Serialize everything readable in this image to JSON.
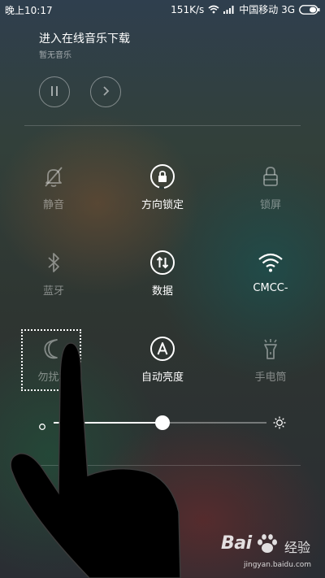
{
  "status_bar": {
    "time": "晚上10:17",
    "speed": "151K/s",
    "carrier": "中国移动 3G"
  },
  "music": {
    "title": "进入在线音乐下载",
    "subtitle": "暂无音乐",
    "pause_icon": "pause-icon",
    "next_icon": "chevron-right-icon"
  },
  "toggles": [
    {
      "label": "静音",
      "icon": "bell-off-icon",
      "active": false
    },
    {
      "label": "方向锁定",
      "icon": "rotation-lock-icon",
      "active": true
    },
    {
      "label": "锁屏",
      "icon": "lock-icon",
      "active": false
    },
    {
      "label": "蓝牙",
      "icon": "bluetooth-icon",
      "active": false
    },
    {
      "label": "数据",
      "icon": "data-arrows-icon",
      "active": true
    },
    {
      "label": "CMCC-",
      "icon": "wifi-icon",
      "active": true
    },
    {
      "label": "勿扰模",
      "icon": "moon-icon",
      "active": false
    },
    {
      "label": "自动亮度",
      "icon": "auto-brightness-icon",
      "active": true
    },
    {
      "label": "手电筒",
      "icon": "flashlight-icon",
      "active": false
    }
  ],
  "brightness": {
    "level": 0.51
  },
  "watermark": {
    "brand": "Bai",
    "brand_suffix": "经验",
    "url": "jingyan.baidu.com"
  },
  "colors": {
    "active_text": "#ffffff",
    "inactive_text": "#8a8d8c"
  }
}
